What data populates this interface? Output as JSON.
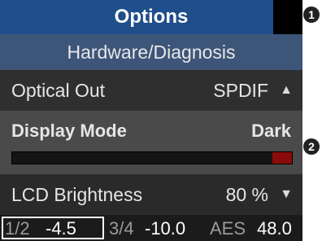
{
  "header": {
    "title": "Options",
    "subtitle": "Hardware/Diagnosis"
  },
  "menu": {
    "optical_out": {
      "label": "Optical Out",
      "value": "SPDIF"
    },
    "display_mode": {
      "label": "Display Mode",
      "value": "Dark",
      "level_fraction": 0.07
    },
    "lcd_brightness": {
      "label": "LCD Brightness",
      "value": "80 %"
    }
  },
  "status": {
    "ch12_label": "1/2",
    "ch12_value": "-4.5",
    "ch34_label": "3/4",
    "ch34_value": "-10.0",
    "source_label": "AES",
    "rate_value": "48.0"
  },
  "callouts": {
    "one": "1",
    "two": "2"
  },
  "colors": {
    "title_bg": "#1f4e8a",
    "subtitle_bg": "#3d5578",
    "selected_bg": "#4a4a4a",
    "level_fill": "#8b0b0b"
  }
}
